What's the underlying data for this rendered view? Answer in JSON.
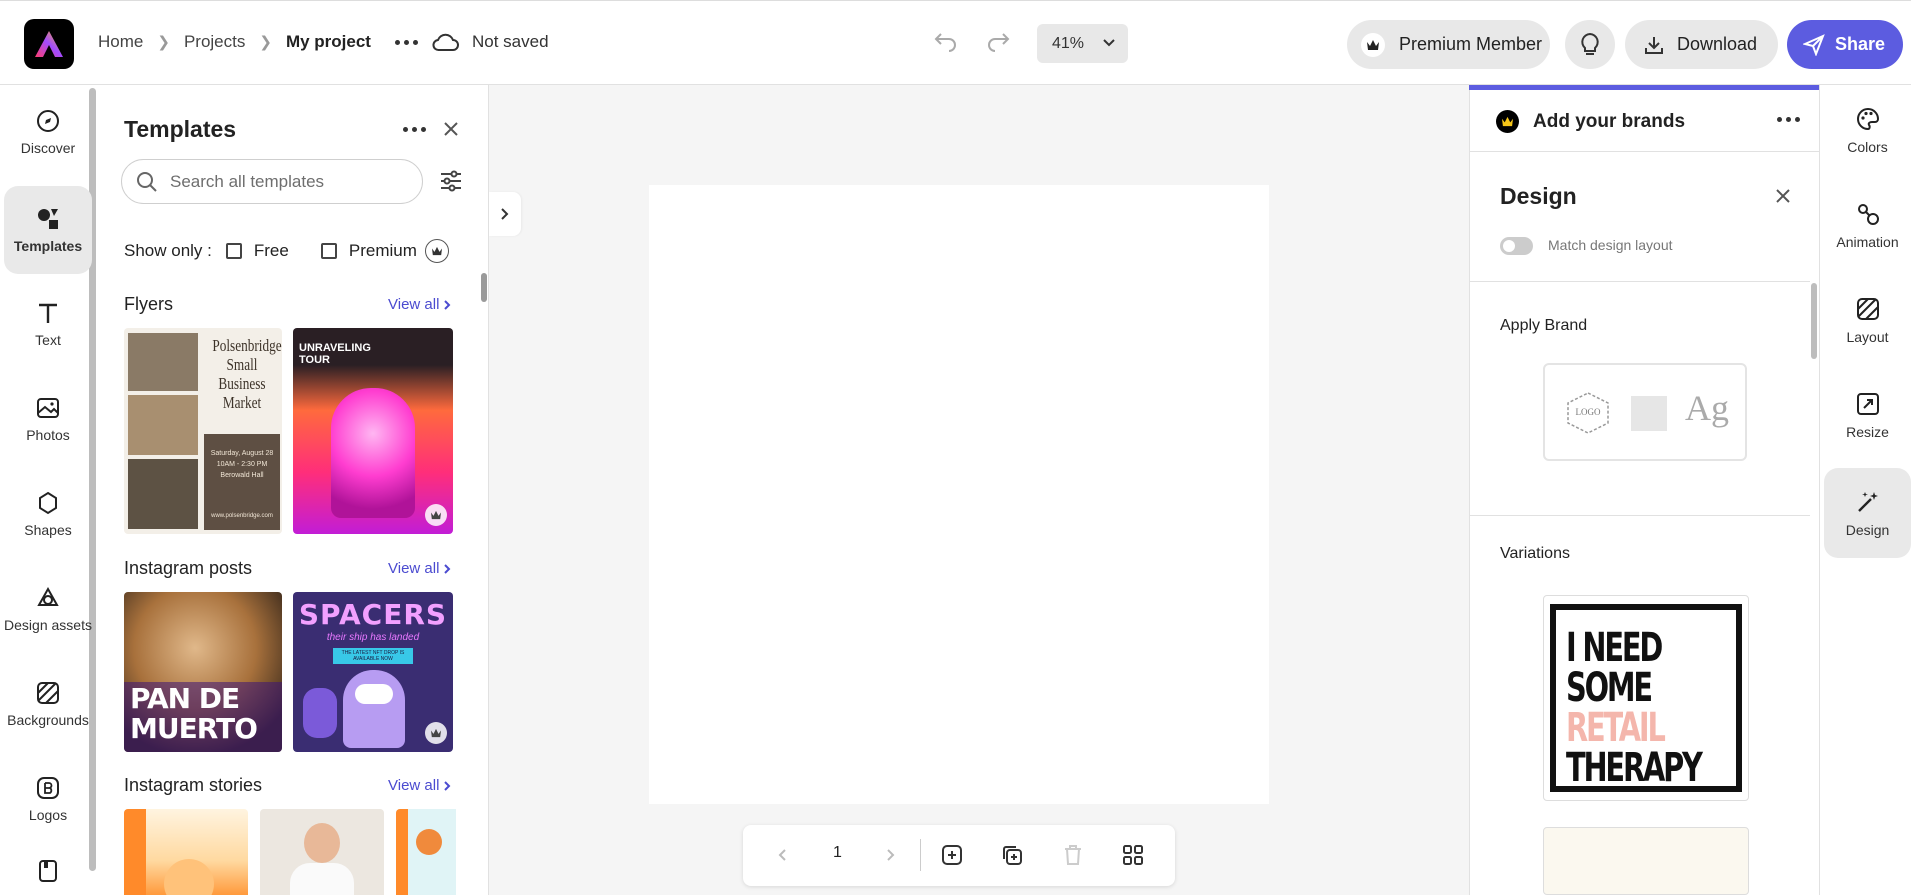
{
  "header": {
    "breadcrumbs": [
      "Home",
      "Projects",
      "My project"
    ],
    "save_status": "Not saved",
    "zoom": "41%",
    "premium_label": "Premium Member",
    "download_label": "Download",
    "share_label": "Share"
  },
  "left_rail": {
    "items": [
      {
        "label": "Discover",
        "icon": "compass-icon"
      },
      {
        "label": "Templates",
        "icon": "templates-icon"
      },
      {
        "label": "Text",
        "icon": "text-icon"
      },
      {
        "label": "Photos",
        "icon": "photo-icon"
      },
      {
        "label": "Shapes",
        "icon": "shapes-icon"
      },
      {
        "label": "Design assets",
        "icon": "design-assets-icon"
      },
      {
        "label": "Backgrounds",
        "icon": "backgrounds-icon"
      },
      {
        "label": "Logos",
        "icon": "logos-icon"
      }
    ],
    "active": "Templates"
  },
  "templates_panel": {
    "title": "Templates",
    "search_placeholder": "Search all templates",
    "show_only_label": "Show only :",
    "filter_free": "Free",
    "filter_premium": "Premium",
    "sections": [
      {
        "title": "Flyers",
        "view_all": "View all"
      },
      {
        "title": "Instagram posts",
        "view_all": "View all"
      },
      {
        "title": "Instagram stories",
        "view_all": "View all"
      }
    ],
    "thumbs": {
      "flyer1_lines": [
        "Polsenbridge",
        "Small Business",
        "Market"
      ],
      "flyer1_date": "Saturday, August 28",
      "flyer1_time": "10AM - 2:30 PM",
      "flyer1_place": "Berowald Hall",
      "flyer1_url": "www.polsenbridge.com",
      "flyer2_title": "UNRAVELING TOUR",
      "post1_lines": [
        "PAN DE",
        "MUERTO"
      ],
      "post2_title": "SPACERS",
      "post2_sub": "their ship has landed",
      "post2_tag": "THE LATEST NFT DROP IS AVAILABLE NOW"
    }
  },
  "canvas": {
    "page_number": "1"
  },
  "right_panel": {
    "brands_title": "Add your brands",
    "design_title": "Design",
    "match_layout_label": "Match design layout",
    "apply_brand_label": "Apply Brand",
    "logo_placeholder": "LOGO",
    "type_sample": "Ag",
    "variations_label": "Variations",
    "variation_lines": [
      "I NEED",
      "SOME",
      "RETAIL",
      "THERAPY"
    ]
  },
  "right_rail": {
    "items": [
      {
        "label": "Colors",
        "icon": "palette-icon"
      },
      {
        "label": "Animation",
        "icon": "animation-icon"
      },
      {
        "label": "Layout",
        "icon": "layout-icon"
      },
      {
        "label": "Resize",
        "icon": "resize-icon"
      },
      {
        "label": "Design",
        "icon": "magic-wand-icon"
      }
    ],
    "active": "Design"
  },
  "colors": {
    "accent": "#5c5ce0",
    "link": "#4b4bd0"
  }
}
